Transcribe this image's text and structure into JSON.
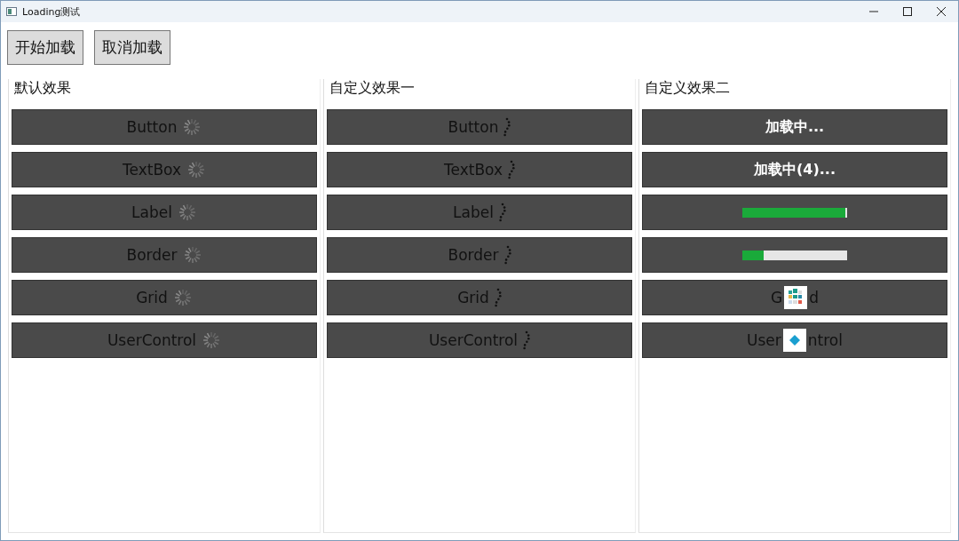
{
  "window": {
    "title": "Loading测试"
  },
  "toolbar": {
    "buttons": [
      "开始加载",
      "取消加载"
    ]
  },
  "panels": [
    {
      "title": "默认效果",
      "items": [
        {
          "label": "Button",
          "overlay": {
            "kind": "spinner"
          }
        },
        {
          "label": "TextBox",
          "overlay": {
            "kind": "spinner"
          }
        },
        {
          "label": "Label",
          "overlay": {
            "kind": "spinner"
          }
        },
        {
          "label": "Border",
          "overlay": {
            "kind": "spinner"
          }
        },
        {
          "label": "Grid",
          "overlay": {
            "kind": "spinner"
          }
        },
        {
          "label": "UserControl",
          "overlay": {
            "kind": "spinner"
          }
        }
      ]
    },
    {
      "title": "自定义效果一",
      "items": [
        {
          "label": "Button",
          "overlay": {
            "kind": "dots"
          }
        },
        {
          "label": "TextBox",
          "overlay": {
            "kind": "dots"
          }
        },
        {
          "label": "Label",
          "overlay": {
            "kind": "dots"
          }
        },
        {
          "label": "Border",
          "overlay": {
            "kind": "dots"
          }
        },
        {
          "label": "Grid",
          "overlay": {
            "kind": "dots"
          }
        },
        {
          "label": "UserControl",
          "overlay": {
            "kind": "dots"
          }
        }
      ]
    },
    {
      "title": "自定义效果二",
      "items": [
        {
          "overlay": {
            "kind": "text",
            "text": "加载中..."
          }
        },
        {
          "overlay": {
            "kind": "text",
            "text": "加载中(4)..."
          }
        },
        {
          "overlay": {
            "kind": "progress",
            "level": 0.98
          }
        },
        {
          "overlay": {
            "kind": "progress",
            "level": 0.2
          }
        },
        {
          "label_parts": [
            "G",
            "d"
          ],
          "overlay": {
            "kind": "tiles"
          }
        },
        {
          "label_parts": [
            "User",
            "ntrol"
          ],
          "overlay": {
            "kind": "diamond"
          }
        }
      ]
    }
  ]
}
